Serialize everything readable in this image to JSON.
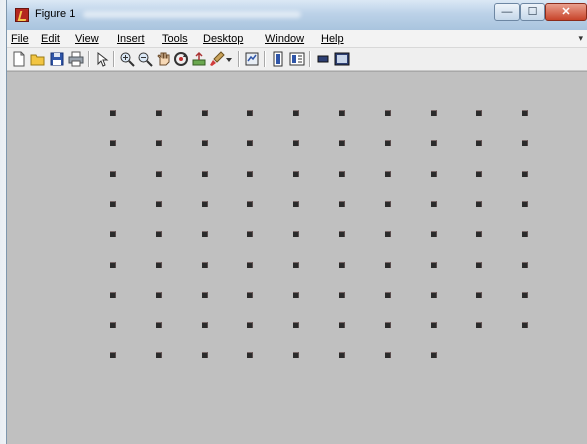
{
  "window": {
    "title": "Figure 1"
  },
  "controls": {
    "minimize": "—",
    "maximize": "☐",
    "close": "✕"
  },
  "menu": {
    "items": [
      "File",
      "Edit",
      "View",
      "Insert",
      "Tools",
      "Desktop",
      "Window",
      "Help"
    ],
    "overflow": "▾"
  },
  "toolbar": {
    "icons": [
      "new-figure-icon",
      "open-file-icon",
      "save-figure-icon",
      "print-figure-icon",
      "edit-plot-icon",
      "zoom-in-icon",
      "zoom-out-icon",
      "pan-icon",
      "rotate-3d-icon",
      "data-cursor-icon",
      "brush-icon",
      "brush-dropdown-icon",
      "link-plot-icon",
      "insert-colorbar-icon",
      "insert-legend-icon",
      "hide-plot-tools-icon",
      "show-plot-tools-icon"
    ]
  },
  "colors": {
    "plot_background": "#c0c0c0",
    "marker": "#2b2b2b",
    "close_button": "#c8442a"
  },
  "chart_data": {
    "type": "scatter",
    "marker": "square",
    "rows": [
      {
        "row": 1,
        "x": [
          1,
          2,
          3,
          4,
          5,
          6,
          7,
          8,
          9,
          10
        ]
      },
      {
        "row": 2,
        "x": [
          1,
          2,
          3,
          4,
          5,
          6,
          7,
          8,
          9,
          10
        ]
      },
      {
        "row": 3,
        "x": [
          1,
          2,
          3,
          4,
          5,
          6,
          7,
          8,
          9,
          10
        ]
      },
      {
        "row": 4,
        "x": [
          1,
          2,
          3,
          4,
          5,
          6,
          7,
          8,
          9,
          10
        ]
      },
      {
        "row": 5,
        "x": [
          1,
          2,
          3,
          4,
          5,
          6,
          7,
          8,
          9,
          10
        ]
      },
      {
        "row": 6,
        "x": [
          1,
          2,
          3,
          4,
          5,
          6,
          7,
          8,
          9,
          10
        ]
      },
      {
        "row": 7,
        "x": [
          1,
          2,
          3,
          4,
          5,
          6,
          7,
          8,
          9,
          10
        ]
      },
      {
        "row": 8,
        "x": [
          1,
          2,
          3,
          4,
          5,
          6,
          7,
          8,
          9,
          10
        ]
      },
      {
        "row": 9,
        "x": [
          1,
          2,
          3,
          4,
          5,
          6,
          7,
          8
        ]
      }
    ]
  }
}
